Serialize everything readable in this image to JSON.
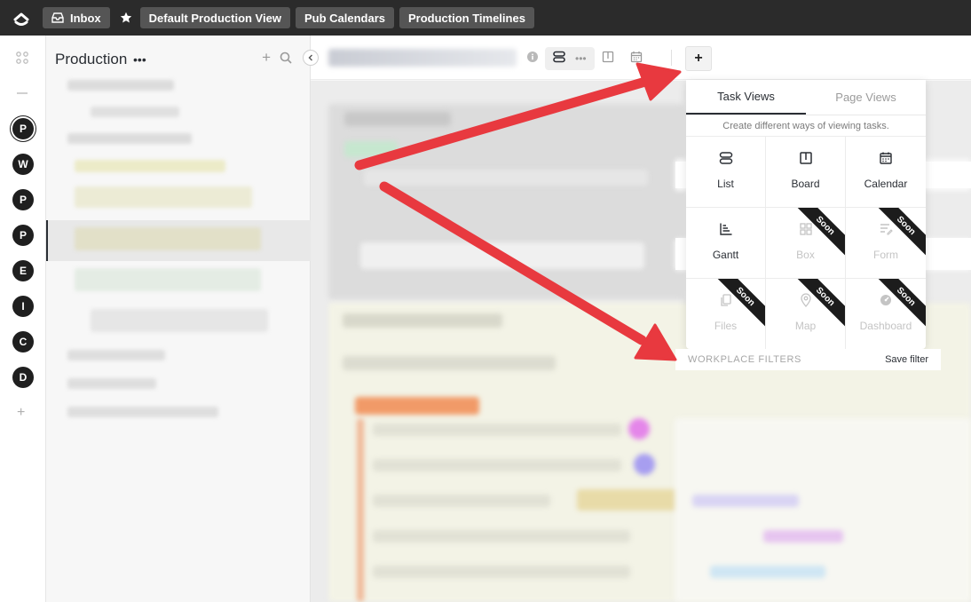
{
  "topbar": {
    "inbox_label": "Inbox",
    "crumbs": [
      {
        "label": "Default Production View"
      },
      {
        "label": "Pub Calendars"
      },
      {
        "label": "Production Timelines"
      }
    ]
  },
  "rail": {
    "workspaces": [
      "P",
      "W",
      "P",
      "P",
      "E",
      "I",
      "C",
      "D"
    ]
  },
  "sidebar": {
    "title": "Production",
    "menu_glyph": "•••"
  },
  "header": {
    "menu_glyph": "•••"
  },
  "popup": {
    "tabs": [
      "Task Views",
      "Page Views"
    ],
    "subtitle": "Create different ways of viewing tasks.",
    "views": [
      {
        "label": "List",
        "icon": "list-icon",
        "soon": false
      },
      {
        "label": "Board",
        "icon": "board-icon",
        "soon": false
      },
      {
        "label": "Calendar",
        "icon": "calendar-icon",
        "soon": false
      },
      {
        "label": "Gantt",
        "icon": "gantt-icon",
        "soon": false
      },
      {
        "label": "Box",
        "icon": "box-icon",
        "soon": true
      },
      {
        "label": "Form",
        "icon": "form-icon",
        "soon": true
      },
      {
        "label": "Files",
        "icon": "files-icon",
        "soon": true
      },
      {
        "label": "Map",
        "icon": "map-icon",
        "soon": true
      },
      {
        "label": "Dashboard",
        "icon": "dashboard-icon",
        "soon": true
      }
    ],
    "soon_label": "Soon",
    "filters_label": "WORKPLACE FILTERS",
    "save_filter_label": "Save filter"
  },
  "colors": {
    "topbar": "#2b2b2b",
    "arrow": "#e8393f"
  }
}
